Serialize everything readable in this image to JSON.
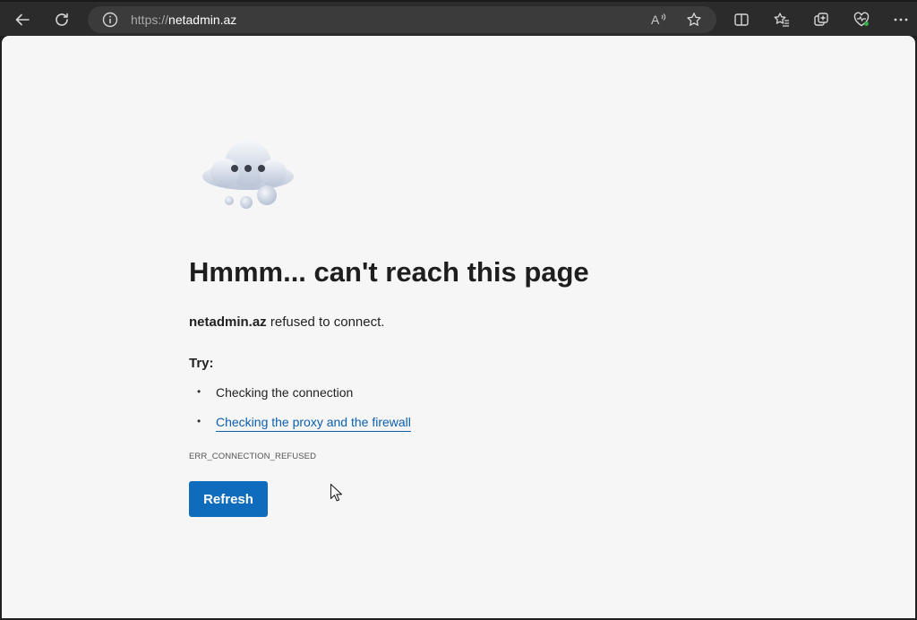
{
  "browser": {
    "url_scheme": "https://",
    "url_host": "netadmin.az",
    "read_aloud_label": "A",
    "icons": [
      "back-icon",
      "refresh-icon",
      "info-icon",
      "read-aloud-icon",
      "favorite-star-icon",
      "split-screen-icon",
      "favorites-icon",
      "collections-icon",
      "browser-essentials-icon",
      "more-icon"
    ]
  },
  "error_page": {
    "title": "Hmmm... can't reach this page",
    "host": "netadmin.az",
    "refused_suffix": " refused to connect.",
    "try_label": "Try:",
    "suggestions": [
      "Checking the connection",
      "Checking the proxy and the firewall"
    ],
    "error_code": "ERR_CONNECTION_REFUSED",
    "refresh_label": "Refresh"
  },
  "colors": {
    "accent": "#0f6cbd",
    "link": "#0a5fae",
    "page_bg": "#f6f6f6",
    "toolbar_bg": "#2b2b2b"
  }
}
